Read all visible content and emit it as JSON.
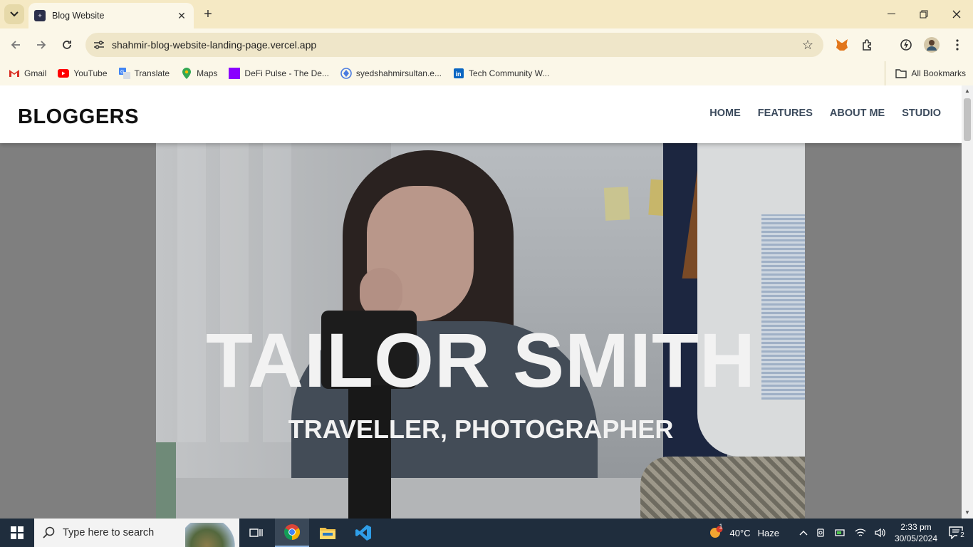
{
  "browser": {
    "tab_title": "Blog Website",
    "url": "shahmir-blog-website-landing-page.vercel.app",
    "bookmarks": [
      {
        "label": "Gmail",
        "icon": "gmail-icon"
      },
      {
        "label": "YouTube",
        "icon": "youtube-icon"
      },
      {
        "label": "Translate",
        "icon": "translate-icon"
      },
      {
        "label": "Maps",
        "icon": "maps-icon"
      },
      {
        "label": "DeFi Pulse - The De...",
        "icon": "defi-pulse-icon"
      },
      {
        "label": "syedshahmirsultan.e...",
        "icon": "site-icon"
      },
      {
        "label": "Tech Community W...",
        "icon": "linkedin-icon"
      }
    ],
    "all_bookmarks": "All Bookmarks"
  },
  "site": {
    "logo": "BLOGGERS",
    "nav": [
      "HOME",
      "FEATURES",
      "ABOUT ME",
      "STUDIO"
    ],
    "hero_title": "TAILOR SMITH",
    "hero_subtitle": "TRAVELLER, PHOTOGRAPHER"
  },
  "taskbar": {
    "search_placeholder": "Type here to search",
    "weather_temp": "40°C",
    "weather_desc": "Haze",
    "weather_badge": "1",
    "time": "2:33 pm",
    "date": "30/05/2024",
    "notification_count": "2"
  },
  "colors": {
    "tabstrip": "#f5e9c4",
    "toolbar": "#fbf7e8",
    "nav_text": "#3b4a5c",
    "taskbar": "#1f2d3d"
  }
}
